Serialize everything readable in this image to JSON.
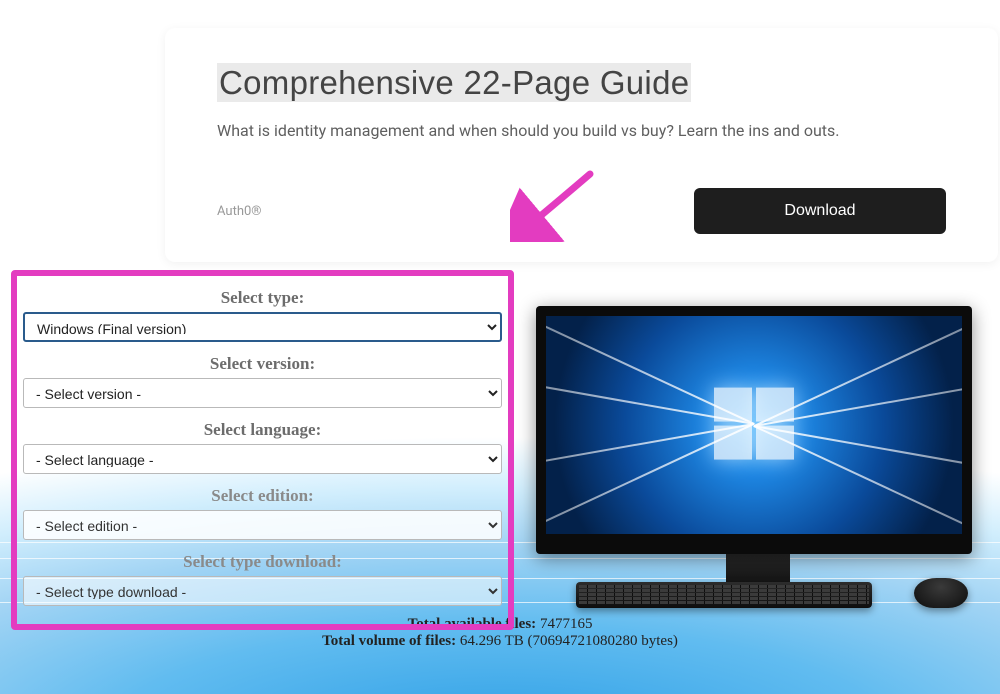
{
  "ad": {
    "title": "Comprehensive 22-Page Guide",
    "description": "What is identity management and when should you build vs buy? Learn the ins and outs.",
    "brand": "Auth0®",
    "button_label": "Download"
  },
  "selectors": {
    "type": {
      "label": "Select type:",
      "value": "Windows (Final version)"
    },
    "version": {
      "label": "Select version:",
      "value": "- Select version -"
    },
    "language": {
      "label": "Select language:",
      "value": "- Select language -"
    },
    "edition": {
      "label": "Select edition:",
      "value": "- Select edition -"
    },
    "download_type": {
      "label": "Select type download:",
      "value": "- Select type download -"
    }
  },
  "stats": {
    "files_label": "Total available files:",
    "files_value": "7477165",
    "volume_label": "Total volume of files:",
    "volume_value": "64.296 TB (70694721080280 bytes)"
  }
}
